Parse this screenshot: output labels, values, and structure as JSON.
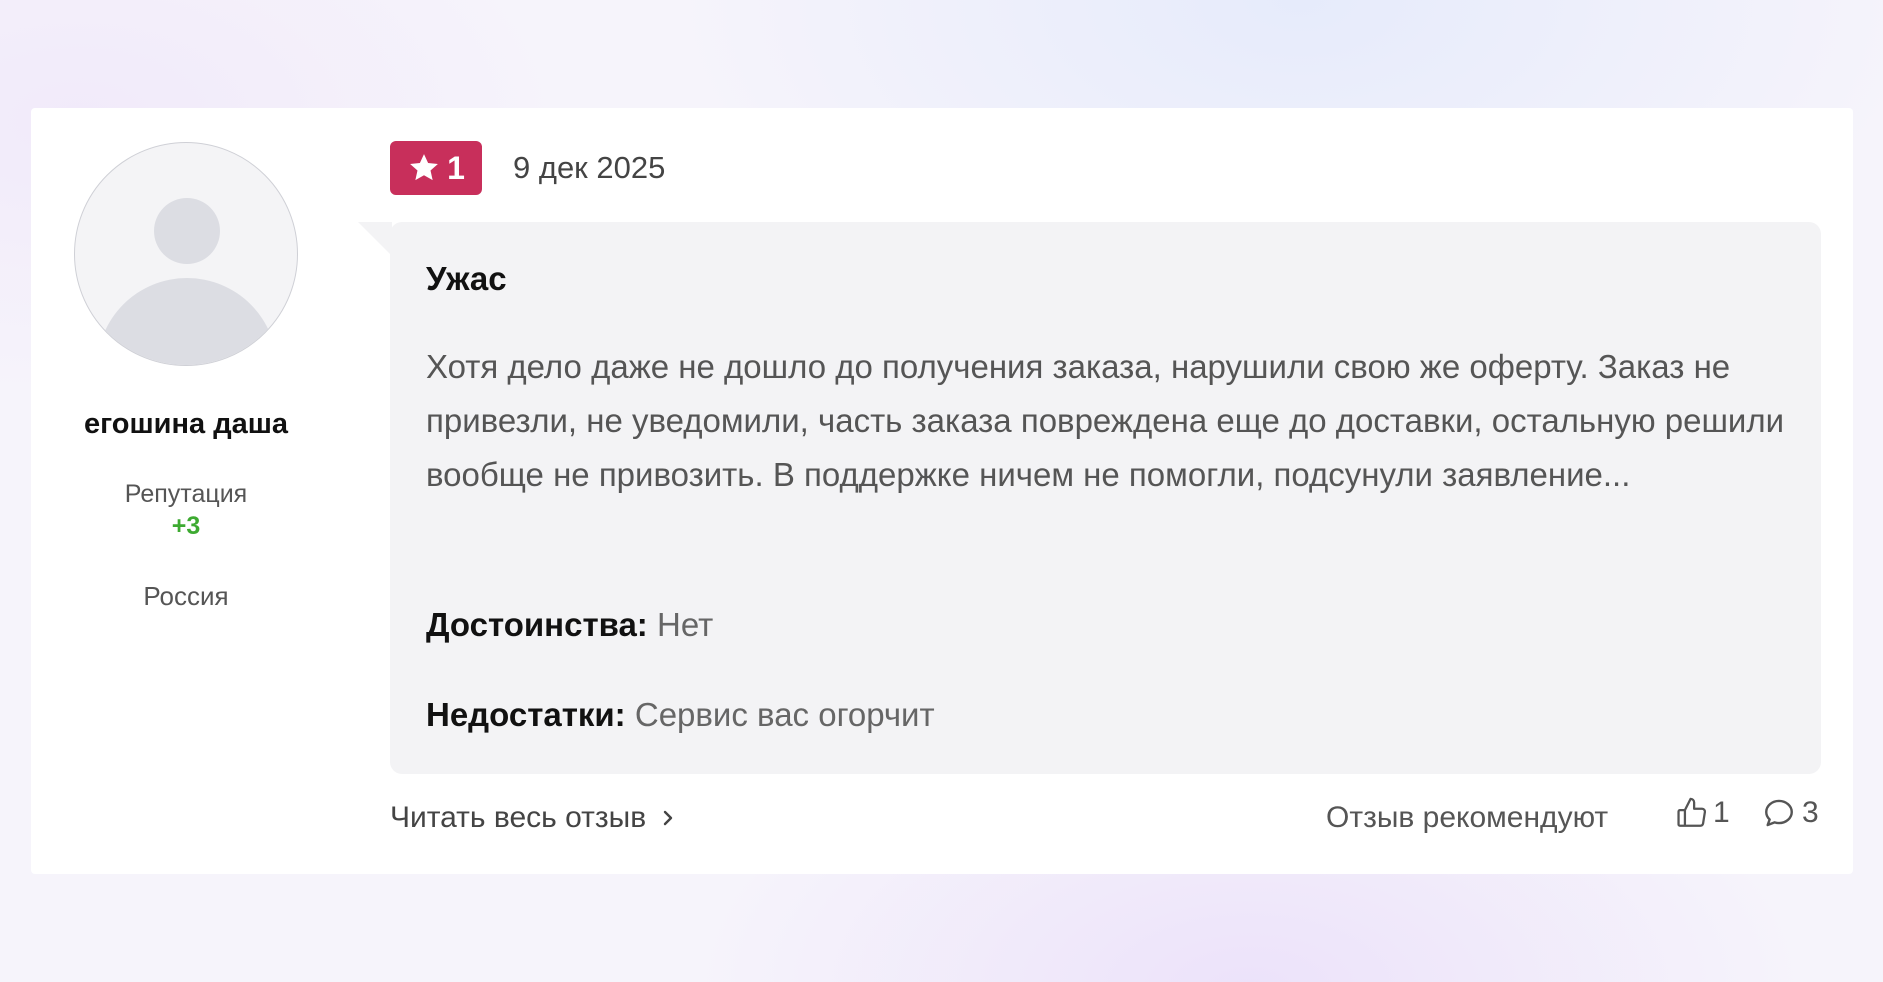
{
  "author": {
    "name": "егошина даша",
    "reputation_label": "Репутация",
    "reputation_value": "+3",
    "country": "Россия"
  },
  "review": {
    "rating": "1",
    "date": "9 дек 2025",
    "title": "Ужас",
    "text": "Хотя дело даже не дошло до получения заказа, нарушили свою же оферту. Заказ не привезли, не уведомили, часть заказа повреждена еще до доставки, остальную решили вообще не привозить. В поддержке ничем не помогли, подсунули заявление...",
    "pros_label": "Достоинства:",
    "pros_value": "Нет",
    "cons_label": "Недостатки:",
    "cons_value": "Сервис вас огорчит"
  },
  "footer": {
    "read_more_label": "Читать весь отзыв",
    "recommend_label": "Отзыв рекомендуют",
    "likes_count": "1",
    "comments_count": "3"
  },
  "icons": {
    "avatar": "user-placeholder-icon",
    "rating": "star-icon",
    "read_more": "chevron-right-icon",
    "likes": "thumbs-up-icon",
    "comments": "speech-bubble-icon"
  },
  "colors": {
    "rating_badge": "#c82f5b",
    "reputation_positive": "#3daa31",
    "bubble_background": "#f3f3f5"
  }
}
